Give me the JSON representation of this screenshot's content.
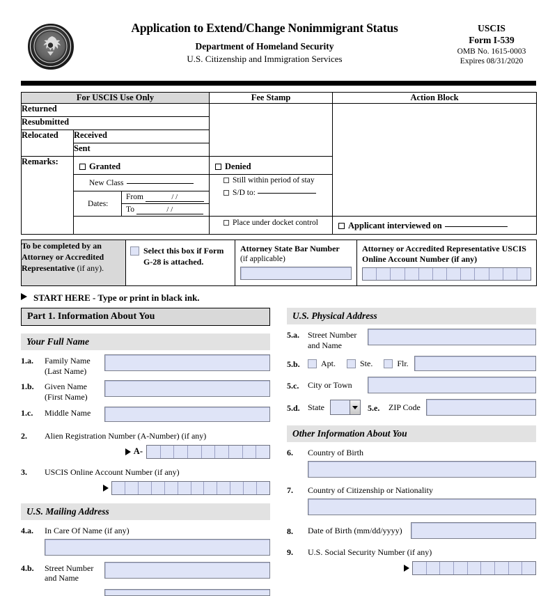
{
  "header": {
    "seal_alt": "dhs-seal",
    "title": "Application to Extend/Change Nonimmigrant Status",
    "department": "Department of Homeland Security",
    "agency": "U.S. Citizenship and Immigration Services",
    "agency_short": "USCIS",
    "form_number": "Form I-539",
    "omb": "OMB No. 1615-0003",
    "expires": "Expires 08/31/2020"
  },
  "uscis_use": {
    "title": "For USCIS Use Only",
    "fee_stamp": "Fee Stamp",
    "action_block": "Action Block",
    "returned": "Returned",
    "resubmitted": "Resubmitted",
    "relocated": "Relocated",
    "received": "Received",
    "sent": "Sent",
    "remarks": "Remarks:",
    "granted": "Granted",
    "new_class": "New Class",
    "dates": "Dates:",
    "from": "From",
    "to": "To",
    "date_slashes": "/          /",
    "denied": "Denied",
    "still_within": "Still within period of stay",
    "sd_to": "S/D to:",
    "docket": "Place under docket control",
    "interviewed": "Applicant interviewed on"
  },
  "attorney": {
    "left_label_bold": "To be completed by an Attorney or Accredited Representative",
    "left_label_note": " (if any).",
    "g28_label": "Select this box if Form G-28 is attached.",
    "bar_number_label": "Attorney State Bar Number",
    "bar_number_note": "(if applicable)",
    "online_acct_label": "Attorney or Accredited Representative USCIS Online Account Number (if any)",
    "online_acct_cells": 12
  },
  "start_here": {
    "text": "START HERE",
    "note": " - Type or print in black ink."
  },
  "part1": {
    "title": "Part 1.  Information About You",
    "full_name_heading": "Your Full Name",
    "items": [
      {
        "num": "1.a.",
        "label": "Family Name\n(Last Name)"
      },
      {
        "num": "1.b.",
        "label": "Given Name\n(First Name)"
      },
      {
        "num": "1.c.",
        "label": "Middle Name"
      }
    ],
    "item2": {
      "num": "2.",
      "label": "Alien Registration Number (A-Number) (if any)",
      "prefix": "A-",
      "cells": 9
    },
    "item3": {
      "num": "3.",
      "label": "USCIS Online Account Number (if any)",
      "cells": 12
    },
    "mailing_heading": "U.S. Mailing Address",
    "item4a": {
      "num": "4.a.",
      "label": "In Care Of Name (if any)"
    },
    "item4b": {
      "num": "4.b.",
      "label": "Street Number\nand Name"
    }
  },
  "physical": {
    "heading": "U.S. Physical Address",
    "item5a": {
      "num": "5.a.",
      "label": "Street Number\nand Name"
    },
    "item5b": {
      "num": "5.b.",
      "options": [
        "Apt.",
        "Ste.",
        "Flr."
      ]
    },
    "item5c": {
      "num": "5.c.",
      "label": "City or Town"
    },
    "item5d": {
      "num": "5.d.",
      "label": "State",
      "value": ""
    },
    "item5e": {
      "num": "5.e.",
      "label": "ZIP Code"
    }
  },
  "other_info": {
    "heading": "Other Information About You",
    "item6": {
      "num": "6.",
      "label": "Country of Birth"
    },
    "item7": {
      "num": "7.",
      "label": "Country of Citizenship or Nationality"
    },
    "item8": {
      "num": "8.",
      "label": "Date of Birth (mm/dd/yyyy)"
    },
    "item9": {
      "num": "9.",
      "label": "U.S. Social Security Number (if any)",
      "cells": 9
    }
  },
  "colors": {
    "field_fill": "#dfe4f7",
    "field_border": "#7b7f8c",
    "section_gray": "#e2e2e2",
    "part_gray": "#d9d9d9"
  }
}
